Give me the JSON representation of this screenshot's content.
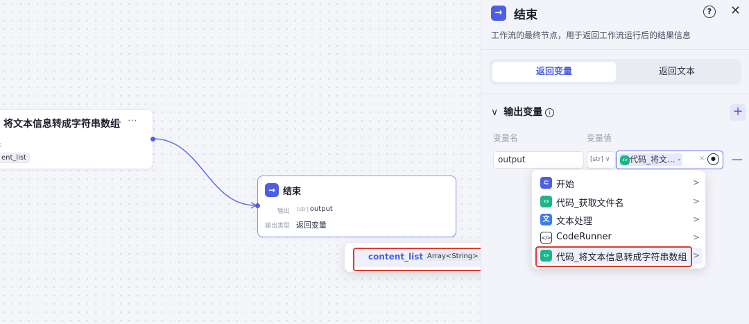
{
  "canvas": {
    "code_node": {
      "title": "将文本信息转成字符串数组",
      "run_icon": "▶",
      "more_icon": "⋯",
      "colon": ":",
      "output_tag": "ent_list"
    },
    "end_node": {
      "title": "结束",
      "output_label": "输出",
      "output_type_chip": "[str]",
      "output_value": "output",
      "output_type_label": "输出类型",
      "output_type_value": "返回变量"
    },
    "var_popup": {
      "var_name": "content_list",
      "var_type": "Array<String>"
    }
  },
  "panel": {
    "title": "结束",
    "help_icon": "?",
    "close_icon": "✕",
    "description": "工作流的最终节点，用于返回工作流运行后的结果信息",
    "tabs": [
      {
        "label": "返回变量",
        "active": true
      },
      {
        "label": "返回文本",
        "active": false
      }
    ],
    "section_title": "输出变量",
    "info_icon": "i",
    "add_icon": "+",
    "col_name_label": "变量名",
    "col_value_label": "变量值",
    "row": {
      "name": "output",
      "type": "[str]",
      "type_chevron": "∨",
      "value_chip": "代码_将文... ",
      "value_chip_sep": "-",
      "clear_icon": "×",
      "remove_icon": "—"
    }
  },
  "menu": {
    "items": [
      {
        "label": "开始",
        "icon": "start-icon",
        "color": "#4e5ee4"
      },
      {
        "label": "代码_获取文件名",
        "icon": "code-icon",
        "color": "#1fb58a"
      },
      {
        "label": "文本处理",
        "icon": "text-process-icon",
        "color": "#3d7bf2"
      },
      {
        "label": "CodeRunner",
        "icon": "code-runner-icon",
        "color": "#ffffff"
      },
      {
        "label": "代码_将文本信息转成字符串数组",
        "icon": "code-icon",
        "color": "#1fb58a"
      }
    ]
  },
  "colors": {
    "accent": "#4e5ee4",
    "highlight": "#e13a2f"
  }
}
